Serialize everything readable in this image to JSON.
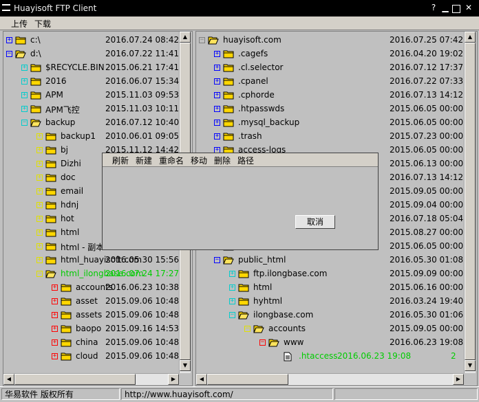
{
  "window": {
    "title": "Huayisoft FTP Client",
    "help": "?",
    "minimize": "▁",
    "maximize": "☐",
    "close": "✕"
  },
  "menu": {
    "upload": "上传",
    "download": "下载"
  },
  "colors": {
    "local_expander": "#0000ff",
    "sub_expander": "#00cccc",
    "leaf_expander": "#e0e000",
    "remote_red": "#ff0000",
    "highlight": "#00cc00"
  },
  "local_tree": [
    {
      "depth": 0,
      "exp": "+",
      "expColor": "#0000ff",
      "icon": "folder",
      "name": "c:\\",
      "date": "2016.07.24 08:42"
    },
    {
      "depth": 0,
      "exp": "-",
      "expColor": "#0000ff",
      "icon": "folder-open",
      "name": "d:\\",
      "date": "2016.07.22 11:41"
    },
    {
      "depth": 1,
      "exp": "+",
      "expColor": "#00cccc",
      "icon": "folder",
      "name": "$RECYCLE.BIN",
      "date": "2015.06.21 17:41"
    },
    {
      "depth": 1,
      "exp": "+",
      "expColor": "#00cccc",
      "icon": "folder",
      "name": "2016",
      "date": "2016.06.07 15:34"
    },
    {
      "depth": 1,
      "exp": "+",
      "expColor": "#00cccc",
      "icon": "folder",
      "name": "APM",
      "date": "2015.11.03 09:53"
    },
    {
      "depth": 1,
      "exp": "+",
      "expColor": "#00cccc",
      "icon": "folder",
      "name": "APM飞控",
      "date": "2015.11.03 10:11"
    },
    {
      "depth": 1,
      "exp": "-",
      "expColor": "#00cccc",
      "icon": "folder-open",
      "name": "backup",
      "date": "2016.07.12 10:40"
    },
    {
      "depth": 2,
      "exp": "+",
      "expColor": "#e0e000",
      "icon": "folder",
      "name": "backup1",
      "date": "2010.06.01 09:05"
    },
    {
      "depth": 2,
      "exp": "+",
      "expColor": "#e0e000",
      "icon": "folder",
      "name": "bj",
      "date": "2015.11.12 14:42"
    },
    {
      "depth": 2,
      "exp": "+",
      "expColor": "#e0e000",
      "icon": "folder",
      "name": "Dizhi",
      "date": ""
    },
    {
      "depth": 2,
      "exp": "+",
      "expColor": "#e0e000",
      "icon": "folder",
      "name": "doc",
      "date": ""
    },
    {
      "depth": 2,
      "exp": "+",
      "expColor": "#e0e000",
      "icon": "folder",
      "name": "email",
      "date": ""
    },
    {
      "depth": 2,
      "exp": "+",
      "expColor": "#e0e000",
      "icon": "folder",
      "name": "hdnj",
      "date": ""
    },
    {
      "depth": 2,
      "exp": "+",
      "expColor": "#e0e000",
      "icon": "folder",
      "name": "hot",
      "date": ""
    },
    {
      "depth": 2,
      "exp": "+",
      "expColor": "#e0e000",
      "icon": "folder",
      "name": "html",
      "date": ""
    },
    {
      "depth": 2,
      "exp": "+",
      "expColor": "#e0e000",
      "icon": "folder",
      "name": "html - 副本",
      "date": ""
    },
    {
      "depth": 2,
      "exp": "+",
      "expColor": "#e0e000",
      "icon": "folder",
      "name": "html_huayisoft.com",
      "date": "2016.05.30 15:56"
    },
    {
      "depth": 2,
      "exp": "-",
      "expColor": "#e0e000",
      "icon": "folder-open",
      "name": "html_ilongbase.com",
      "date": "2016.07.24 17:27",
      "highlight": true
    },
    {
      "depth": 3,
      "exp": "+",
      "expColor": "#ff0000",
      "icon": "folder",
      "name": "accounts",
      "date": "2016.06.23 10:38"
    },
    {
      "depth": 3,
      "exp": "+",
      "expColor": "#ff0000",
      "icon": "folder",
      "name": "asset",
      "date": "2015.09.06 10:48"
    },
    {
      "depth": 3,
      "exp": "+",
      "expColor": "#ff0000",
      "icon": "folder",
      "name": "assets",
      "date": "2015.09.06 10:48"
    },
    {
      "depth": 3,
      "exp": "+",
      "expColor": "#ff0000",
      "icon": "folder",
      "name": "baopo",
      "date": "2015.09.16 14:53"
    },
    {
      "depth": 3,
      "exp": "+",
      "expColor": "#ff0000",
      "icon": "folder",
      "name": "china",
      "date": "2015.09.06 10:48"
    },
    {
      "depth": 3,
      "exp": "+",
      "expColor": "#ff0000",
      "icon": "folder",
      "name": "cloud",
      "date": "2015.09.06 10:48"
    }
  ],
  "remote_tree": [
    {
      "depth": 0,
      "exp": "-",
      "expColor": "#808080",
      "icon": "folder-open",
      "name": "huayisoft.com",
      "date": "2016.07.25 07:42"
    },
    {
      "depth": 1,
      "exp": "+",
      "expColor": "#0000ff",
      "icon": "folder",
      "name": ".cagefs",
      "date": "2016.04.20 19:02"
    },
    {
      "depth": 1,
      "exp": "+",
      "expColor": "#0000ff",
      "icon": "folder",
      "name": ".cl.selector",
      "date": "2016.07.12 17:37"
    },
    {
      "depth": 1,
      "exp": "+",
      "expColor": "#0000ff",
      "icon": "folder",
      "name": ".cpanel",
      "date": "2016.07.22 07:33"
    },
    {
      "depth": 1,
      "exp": "+",
      "expColor": "#0000ff",
      "icon": "folder",
      "name": ".cphorde",
      "date": "2016.07.13 14:12"
    },
    {
      "depth": 1,
      "exp": "+",
      "expColor": "#0000ff",
      "icon": "folder",
      "name": ".htpasswds",
      "date": "2015.06.05 00:00"
    },
    {
      "depth": 1,
      "exp": "+",
      "expColor": "#0000ff",
      "icon": "folder",
      "name": ".mysql_backup",
      "date": "2015.06.05 00:00"
    },
    {
      "depth": 1,
      "exp": "+",
      "expColor": "#0000ff",
      "icon": "folder",
      "name": ".trash",
      "date": "2015.07.23 00:00"
    },
    {
      "depth": 1,
      "exp": "+",
      "expColor": "#0000ff",
      "icon": "folder",
      "name": "access-logs",
      "date": "2015.06.05 00:00"
    },
    {
      "depth": 1,
      "exp": "+",
      "expColor": "#0000ff",
      "icon": "folder",
      "name": "",
      "date": "2015.06.13 00:00"
    },
    {
      "depth": 1,
      "exp": "+",
      "expColor": "#0000ff",
      "icon": "folder",
      "name": "",
      "date": "2016.07.13 14:12"
    },
    {
      "depth": 1,
      "exp": "+",
      "expColor": "#0000ff",
      "icon": "folder",
      "name": "",
      "date": "2015.09.05 00:00"
    },
    {
      "depth": 1,
      "exp": "+",
      "expColor": "#0000ff",
      "icon": "folder",
      "name": "",
      "date": "2015.09.04 00:00"
    },
    {
      "depth": 1,
      "exp": "+",
      "expColor": "#0000ff",
      "icon": "folder",
      "name": "",
      "date": "2016.07.18 05:04"
    },
    {
      "depth": 1,
      "exp": "+",
      "expColor": "#0000ff",
      "icon": "folder",
      "name": "",
      "date": "2015.08.27 00:00"
    },
    {
      "depth": 1,
      "exp": "+",
      "expColor": "#0000ff",
      "icon": "folder",
      "name": "",
      "date": "2015.06.05 00:00"
    },
    {
      "depth": 1,
      "exp": "-",
      "expColor": "#0000ff",
      "icon": "folder-open",
      "name": "public_html",
      "date": "2016.05.30 01:08"
    },
    {
      "depth": 2,
      "exp": "+",
      "expColor": "#00cccc",
      "icon": "folder",
      "name": "ftp.ilongbase.com",
      "date": "2015.09.09 00:00"
    },
    {
      "depth": 2,
      "exp": "+",
      "expColor": "#00cccc",
      "icon": "folder",
      "name": "html",
      "date": "2015.06.16 00:00"
    },
    {
      "depth": 2,
      "exp": "+",
      "expColor": "#00cccc",
      "icon": "folder",
      "name": "hyhtml",
      "date": "2016.03.24 19:40"
    },
    {
      "depth": 2,
      "exp": "-",
      "expColor": "#00cccc",
      "icon": "folder-open",
      "name": "ilongbase.com",
      "date": "2016.05.30 01:06"
    },
    {
      "depth": 3,
      "exp": "-",
      "expColor": "#e0e000",
      "icon": "folder-open",
      "name": "accounts",
      "date": "2015.09.05 00:00"
    },
    {
      "depth": 4,
      "exp": "-",
      "expColor": "#ff0000",
      "icon": "folder-open",
      "name": "www",
      "date": "2016.06.23 19:08"
    },
    {
      "depth": 5,
      "exp": "",
      "expColor": "",
      "icon": "file",
      "name": ".htaccess",
      "date": "2016.06.23 19:08",
      "size": "2",
      "highlight": true
    }
  ],
  "context_menu": {
    "refresh": "刷新",
    "new": "新建",
    "rename": "重命名",
    "move": "移动",
    "delete": "删除",
    "path": "路径"
  },
  "dialog": {
    "cancel": "取消"
  },
  "status": {
    "copyright": "华易软件 版权所有",
    "url": "http://www.huayisoft.com/"
  }
}
